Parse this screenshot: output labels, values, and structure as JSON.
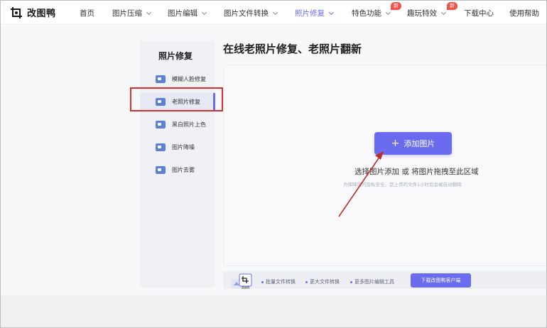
{
  "brand": {
    "name": "改图鸭"
  },
  "nav": [
    {
      "label": "首页",
      "dropdown": false
    },
    {
      "label": "图片压缩",
      "dropdown": true
    },
    {
      "label": "图片编辑",
      "dropdown": true
    },
    {
      "label": "图片文件转换",
      "dropdown": true
    },
    {
      "label": "照片修复",
      "dropdown": true,
      "active": true
    },
    {
      "label": "特色功能",
      "dropdown": true,
      "badge": "新"
    },
    {
      "label": "趣玩特效",
      "dropdown": true,
      "badge": "新"
    },
    {
      "label": "下载中心",
      "dropdown": false
    },
    {
      "label": "使用帮助",
      "dropdown": false
    }
  ],
  "sidebar": {
    "title": "照片修复",
    "items": [
      {
        "label": "模糊人脸修复",
        "icon": "face-photo-icon"
      },
      {
        "label": "老照片修复",
        "icon": "old-photo-icon",
        "active": true
      },
      {
        "label": "黑白照片上色",
        "icon": "colorize-icon"
      },
      {
        "label": "图片降噪",
        "icon": "denoise-icon"
      },
      {
        "label": "图片去雾",
        "icon": "defog-icon"
      }
    ]
  },
  "main": {
    "title": "在线老照片修复、老照片翻新",
    "add_button": "添加图片",
    "hint": "选择图片添加 或 将图片拖拽至此区域",
    "privacy": "为保障您的隐私安全，您上传的文件1小时后会被自动删除"
  },
  "bottom": {
    "app_label": "改图鸭",
    "features": [
      "批量文件转换",
      "更大文件转换",
      "更多图片编辑工具"
    ],
    "download_button": "下载改图鸭客户端"
  },
  "colors": {
    "accent": "#6a6bee",
    "highlight_box": "#d9302c",
    "arrow": "#b3332c"
  }
}
